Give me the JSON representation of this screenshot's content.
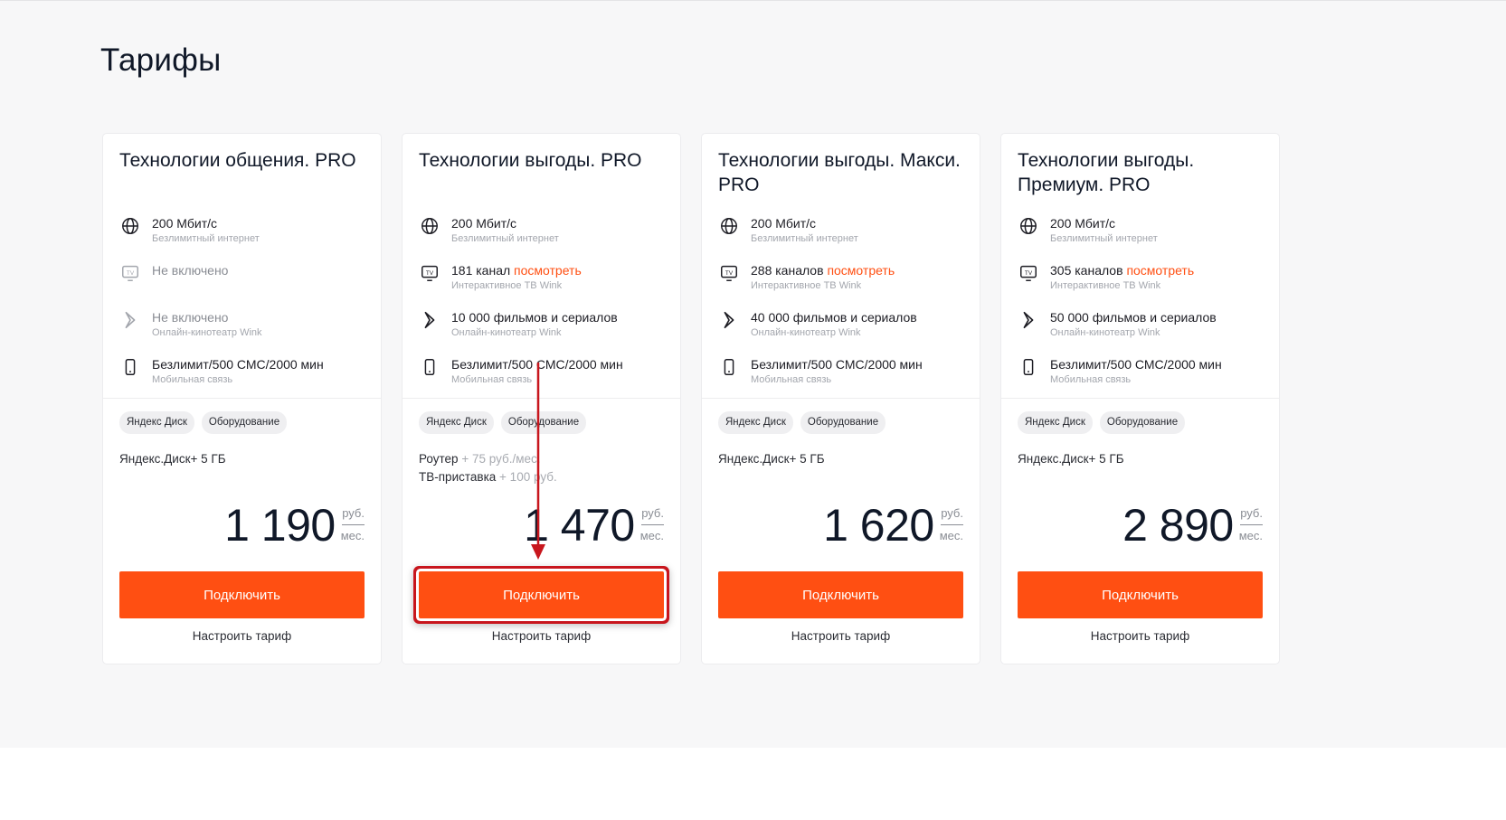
{
  "page": {
    "title": "Тарифы"
  },
  "colors": {
    "accent": "#ff4f12",
    "annotation": "#c8161d",
    "background": "#f7f7f8"
  },
  "icons": {
    "internet": "globe-icon",
    "tv": "tv-icon",
    "cinema": "wink-icon",
    "mobile": "phone-icon"
  },
  "cards": [
    {
      "title": "Технологии общения. PRO",
      "features": [
        {
          "value": "200 Мбит/с",
          "sub": "Безлимитный интернет"
        },
        {
          "value": "Не включено"
        },
        {
          "value": "Не включено",
          "sub": "Онлайн-кинотеатр Wink"
        },
        {
          "value": "Безлимит/500 СМС/2000 мин",
          "sub": "Мобильная связь"
        }
      ],
      "tags": [
        "Яндекс Диск",
        "Оборудование"
      ],
      "extra_line1": "Яндекс.Диск+ 5 ГБ",
      "price": "1 190",
      "price_unit_top": "руб.",
      "price_unit_bottom": "мес.",
      "button": "Подключить",
      "configure": "Настроить тариф"
    },
    {
      "title": "Технологии выгоды. PRO",
      "features": [
        {
          "value": "200 Мбит/с",
          "sub": "Безлимитный интернет"
        },
        {
          "value": "181 канал",
          "link": "посмотреть",
          "sub": "Интерактивное ТВ Wink"
        },
        {
          "value": "10 000 фильмов и сериалов",
          "sub": "Онлайн-кинотеатр Wink"
        },
        {
          "value": "Безлимит/500 СМС/2000 мин",
          "sub": "Мобильная связь"
        }
      ],
      "tags": [
        "Яндекс Диск",
        "Оборудование"
      ],
      "extra_line1": "Роутер",
      "extra_line1_add": "+ 75 руб./мес.",
      "extra_line2": "ТВ-приставка",
      "extra_line2_add": "+ 100 руб.",
      "price": "1 470",
      "price_unit_top": "руб.",
      "price_unit_bottom": "мес.",
      "button": "Подключить",
      "configure": "Настроить тариф"
    },
    {
      "title": "Технологии выгоды. Макси. PRO",
      "features": [
        {
          "value": "200 Мбит/с",
          "sub": "Безлимитный интернет"
        },
        {
          "value": "288 каналов",
          "link": "посмотреть",
          "sub": "Интерактивное ТВ Wink"
        },
        {
          "value": "40 000 фильмов и сериалов",
          "sub": "Онлайн-кинотеатр Wink"
        },
        {
          "value": "Безлимит/500 СМС/2000 мин",
          "sub": "Мобильная связь"
        }
      ],
      "tags": [
        "Яндекс Диск",
        "Оборудование"
      ],
      "extra_line1": "Яндекс.Диск+ 5 ГБ",
      "price": "1 620",
      "price_unit_top": "руб.",
      "price_unit_bottom": "мес.",
      "button": "Подключить",
      "configure": "Настроить тариф"
    },
    {
      "title": "Технологии выгоды. Премиум. PRO",
      "features": [
        {
          "value": "200 Мбит/с",
          "sub": "Безлимитный интернет"
        },
        {
          "value": "305 каналов",
          "link": "посмотреть",
          "sub": "Интерактивное ТВ Wink"
        },
        {
          "value": "50 000 фильмов и сериалов",
          "sub": "Онлайн-кинотеатр Wink"
        },
        {
          "value": "Безлимит/500 СМС/2000 мин",
          "sub": "Мобильная связь"
        }
      ],
      "tags": [
        "Яндекс Диск",
        "Оборудование"
      ],
      "extra_line1": "Яндекс.Диск+ 5 ГБ",
      "price": "2 890",
      "price_unit_top": "руб.",
      "price_unit_bottom": "мес.",
      "button": "Подключить",
      "configure": "Настроить тариф"
    }
  ]
}
